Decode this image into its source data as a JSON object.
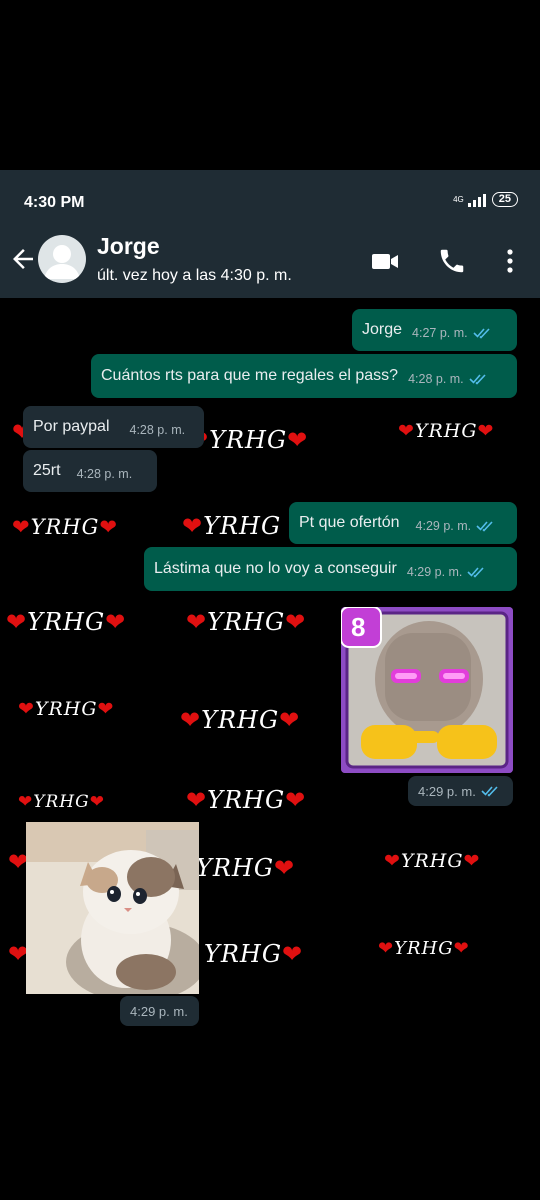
{
  "status": {
    "time": "4:30 PM",
    "network": "4G",
    "battery": "25"
  },
  "header": {
    "name": "Jorge",
    "last_seen": "últ. vez hoy a las 4:30 p. m."
  },
  "watermark": {
    "text": "YRHG"
  },
  "messages": [
    {
      "text": "Jorge",
      "time": "4:27 p. m."
    },
    {
      "text": "Cuántos rts para que me regales el pass?",
      "time": "4:28 p. m."
    },
    {
      "text": "Por paypal",
      "time": "4:28 p. m."
    },
    {
      "text": "25rt",
      "time": "4:28 p. m."
    },
    {
      "text": "Pt que ofertón",
      "time": "4:29 p. m."
    },
    {
      "text": "Lástima que no lo voy a conseguir",
      "time": "4:29 p. m."
    }
  ],
  "sticker": {
    "badge": "8",
    "time": "4:29 p. m."
  },
  "image_message": {
    "time": "4:29 p. m."
  }
}
